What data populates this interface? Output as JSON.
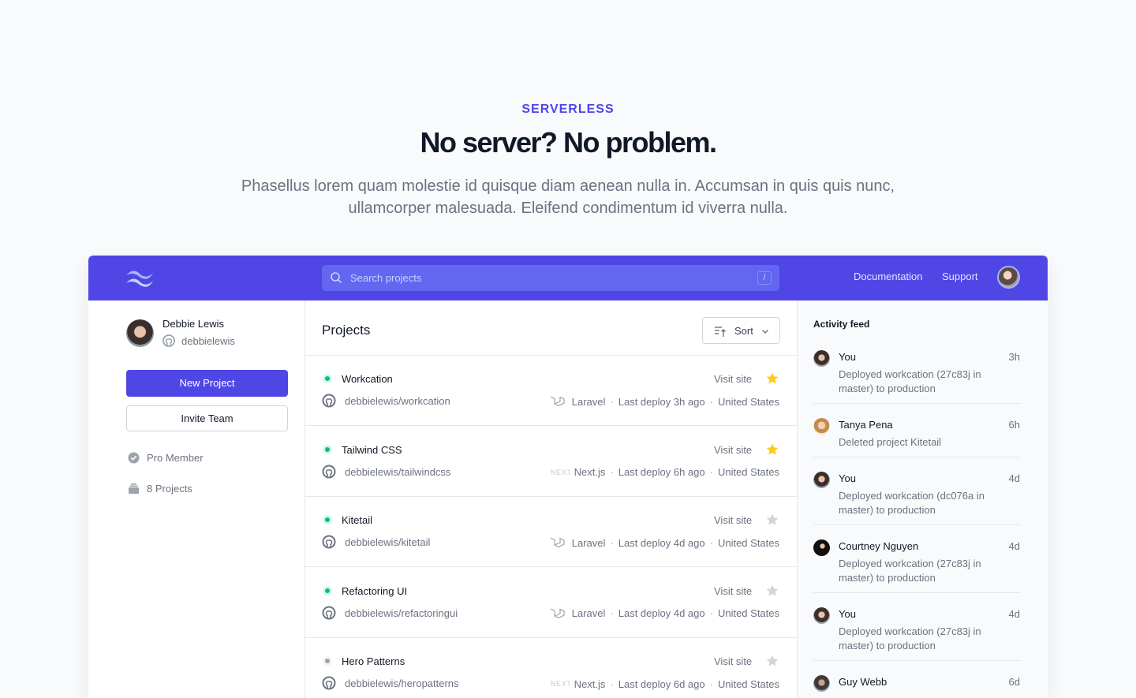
{
  "hero": {
    "eyebrow": "SERVERLESS",
    "headline": "No server? No problem.",
    "subtitle": "Phasellus lorem quam molestie id quisque diam aenean nulla in. Accumsan in quis quis nunc, ullamcorper malesuada. Eleifend condimentum id viverra nulla."
  },
  "topbar": {
    "search_placeholder": "Search projects",
    "search_shortcut": "/",
    "nav": [
      "Documentation",
      "Support"
    ],
    "colors": {
      "bar": "#4f46e5",
      "search": "#6366f1"
    }
  },
  "profile": {
    "name": "Debbie Lewis",
    "handle": "debbielewis",
    "new_project_label": "New Project",
    "invite_team_label": "Invite Team",
    "badge_label": "Pro Member",
    "projects_count_label": "8 Projects"
  },
  "projects": {
    "title": "Projects",
    "sort_label": "Sort",
    "visit_label": "Visit site",
    "items": [
      {
        "name": "Workcation",
        "repo": "debbielewis/workcation",
        "framework": "Laravel",
        "framework_icon": "laravel-icon",
        "deploy": "Last deploy 3h ago",
        "region": "United States",
        "starred": true,
        "status": "active"
      },
      {
        "name": "Tailwind CSS",
        "repo": "debbielewis/tailwindcss",
        "framework": "Next.js",
        "framework_icon": "nextjs-icon",
        "deploy": "Last deploy 6h ago",
        "region": "United States",
        "starred": true,
        "status": "active"
      },
      {
        "name": "Kitetail",
        "repo": "debbielewis/kitetail",
        "framework": "Laravel",
        "framework_icon": "laravel-icon",
        "deploy": "Last deploy 4d ago",
        "region": "United States",
        "starred": false,
        "status": "active"
      },
      {
        "name": "Refactoring UI",
        "repo": "debbielewis/refactoringui",
        "framework": "Laravel",
        "framework_icon": "laravel-icon",
        "deploy": "Last deploy 4d ago",
        "region": "United States",
        "starred": false,
        "status": "active"
      },
      {
        "name": "Hero Patterns",
        "repo": "debbielewis/heropatterns",
        "framework": "Next.js",
        "framework_icon": "nextjs-icon",
        "deploy": "Last deploy 6d ago",
        "region": "United States",
        "starred": false,
        "status": "inactive"
      }
    ]
  },
  "activity": {
    "title": "Activity feed",
    "items": [
      {
        "name": "You",
        "time": "3h",
        "text": "Deployed workcation (27c83j in master) to production"
      },
      {
        "name": "Tanya Pena",
        "time": "6h",
        "text": "Deleted project Kitetail"
      },
      {
        "name": "You",
        "time": "4d",
        "text": "Deployed workcation (dc076a in master) to production"
      },
      {
        "name": "Courtney Nguyen",
        "time": "4d",
        "text": "Deployed workcation (27c83j in master) to production"
      },
      {
        "name": "You",
        "time": "4d",
        "text": "Deployed workcation (27c83j in master) to production"
      },
      {
        "name": "Guy Webb",
        "time": "6d",
        "text": ""
      }
    ]
  }
}
